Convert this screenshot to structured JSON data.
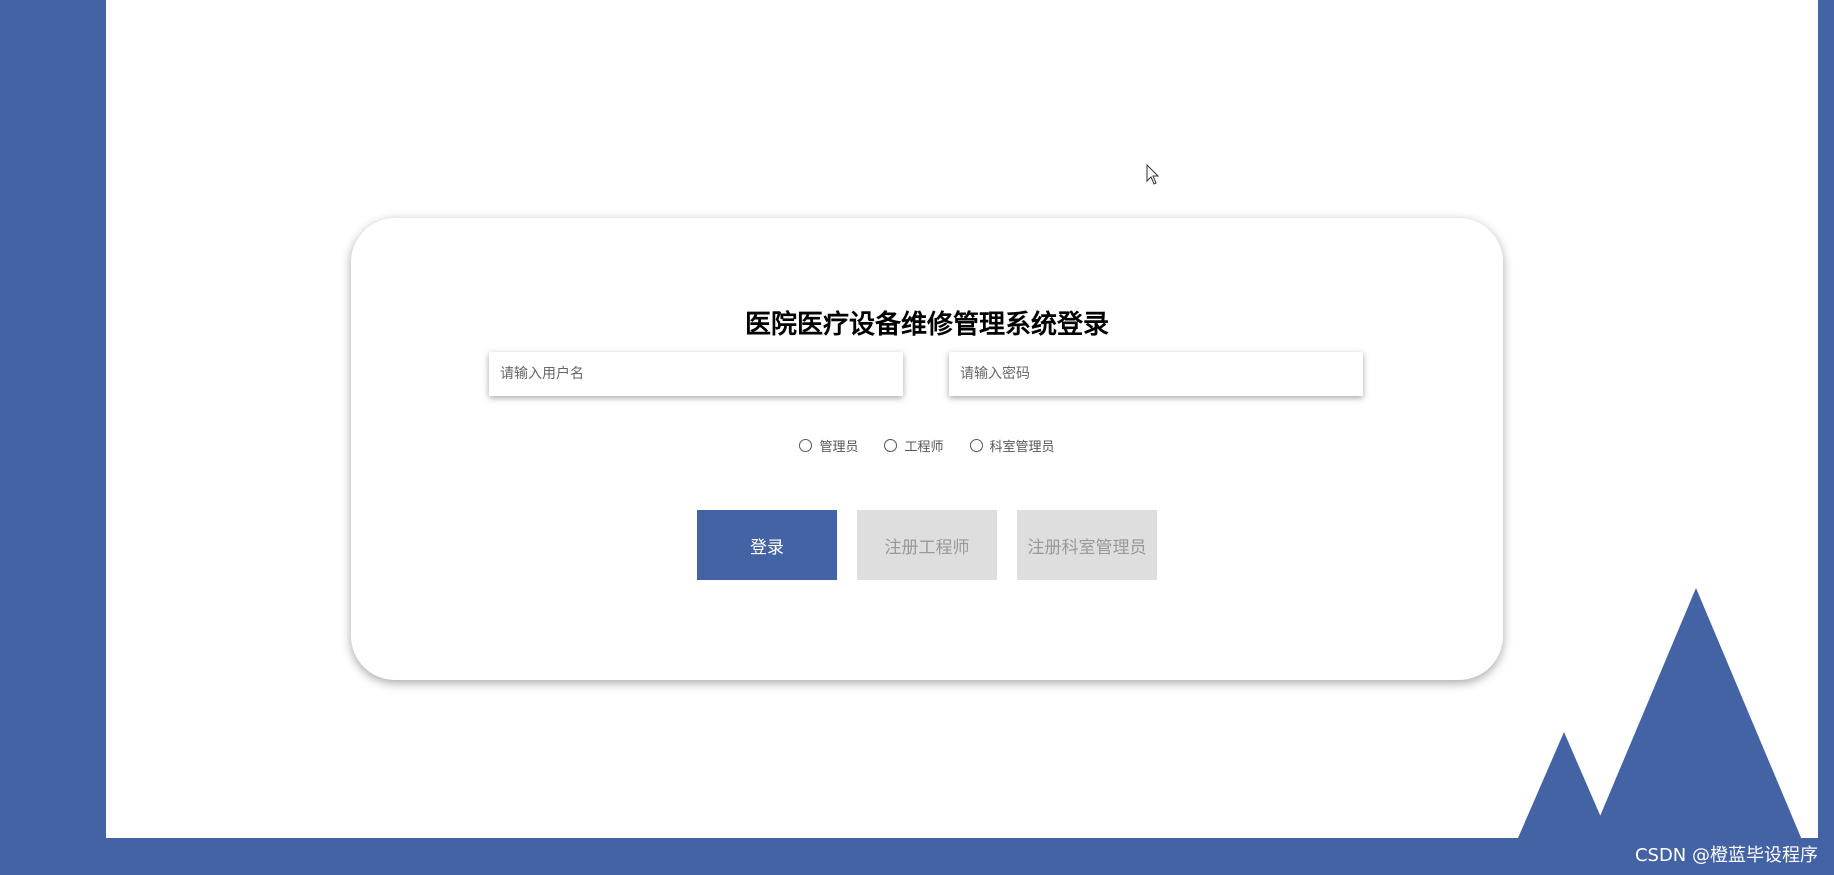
{
  "login": {
    "title": "医院医疗设备维修管理系统登录",
    "username_placeholder": "请输入用户名",
    "password_placeholder": "请输入密码",
    "roles": [
      {
        "label": "管理员"
      },
      {
        "label": "工程师"
      },
      {
        "label": "科室管理员"
      }
    ],
    "buttons": {
      "login": "登录",
      "register_engineer": "注册工程师",
      "register_dept_admin": "注册科室管理员"
    }
  },
  "watermark": "CSDN @橙蓝毕设程序",
  "colors": {
    "brand": "#4463a4",
    "secondary_button": "#dedede",
    "secondary_text": "#999999"
  }
}
